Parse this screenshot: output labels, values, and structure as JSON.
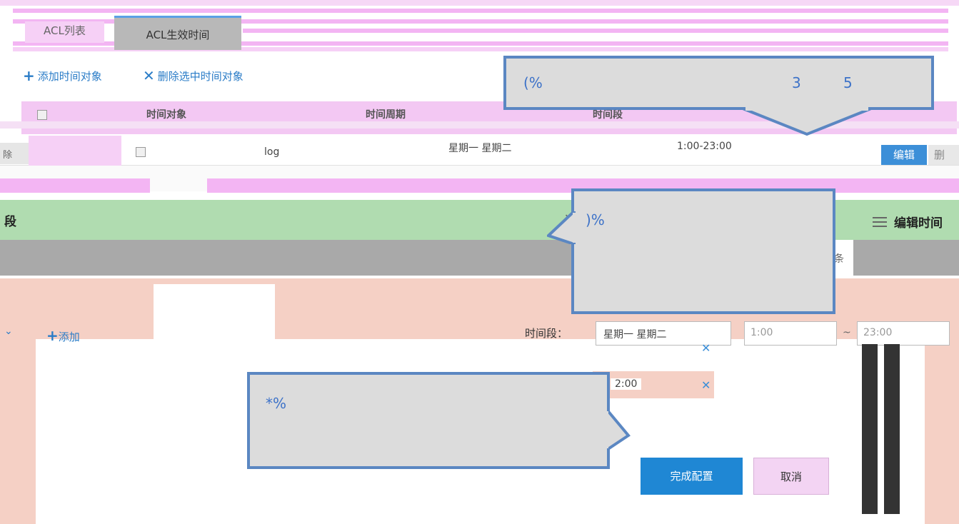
{
  "tabs": [
    {
      "label": "ACL列表"
    },
    {
      "label": "ACL生效时间"
    }
  ],
  "toolbar": {
    "add_label": "添加时间对象",
    "delete_label": "删除选中时间对象"
  },
  "table": {
    "columns": [
      "时间对象",
      "时间周期",
      "时间段"
    ],
    "rows": [
      {
        "name": "log",
        "period": "星期一 星期二",
        "range": "1:00-23:00",
        "edit_label": "编辑",
        "delete_label": "删"
      }
    ],
    "left_delete": "除"
  },
  "dialog": {
    "title": "段",
    "right_title": "编辑时间",
    "strip_label": "条",
    "add_label": "添加",
    "time_label": "时间段：",
    "select_value": "星期一 星期二",
    "start_time": "1:00",
    "end_time": "23:00",
    "row2_time": "2:00",
    "done_label": "完成配置",
    "cancel_label": "取消"
  },
  "callouts": {
    "a_left": "(%",
    "a_mid": "3",
    "a_right": "5",
    "b_text": ")%",
    "c_text": "*%"
  },
  "colors": {
    "accent": "#1f87d4",
    "callout_border": "#5b87c2",
    "link": "#2a7cc7",
    "dialog_header": "#b0dcb0"
  }
}
